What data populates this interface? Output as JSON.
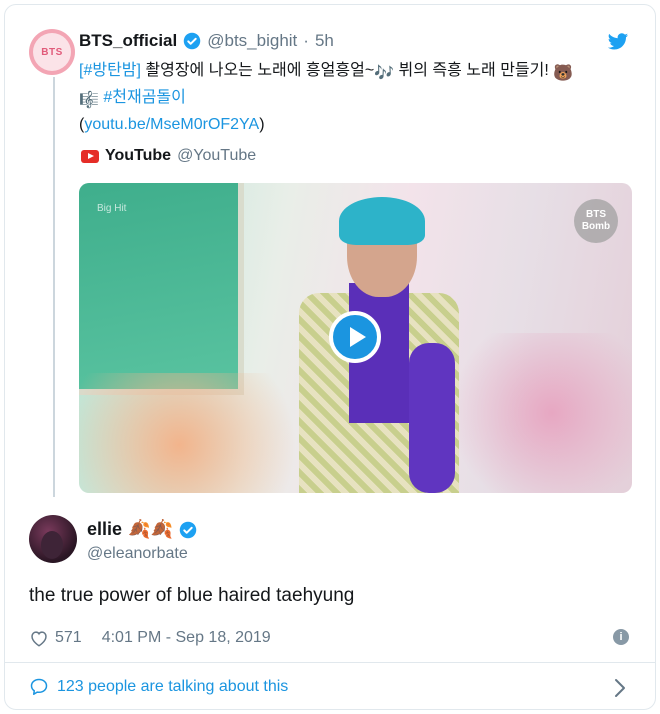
{
  "quoted": {
    "avatar_text": "BTS",
    "name": "BTS_official",
    "handle": "@bts_bighit",
    "separator": "·",
    "time": "5h",
    "hashtag1": "[#방탄밤]",
    "text1": " 촬영장에 나오는 노래에 흥얼흥얼~",
    "text2": " 뷔의 즉흥 노래 만들기! ",
    "hashtag2": " #천재곰돌이",
    "link_open": "(",
    "link": "youtu.be/MseM0rOF2YA",
    "link_close": ")",
    "music_emoji": "🎶",
    "bear_emoji": "🐻",
    "clef_emoji": "🎼"
  },
  "card": {
    "source_name": "YouTube",
    "source_handle": "@YouTube",
    "badge_line1": "BTS",
    "badge_line2": "Bomb",
    "watermark": "Big Hit"
  },
  "tweet": {
    "name": "ellie",
    "name_emoji": "🍂🍂",
    "handle": "@eleanorbate",
    "text": "the true power of blue haired taehyung",
    "likes": "571",
    "timestamp": "4:01 PM - Sep 18, 2019",
    "talking": "123 people are talking about this"
  },
  "colors": {
    "link": "#1b95e0",
    "muted": "#657786",
    "verified": "#1da1f2"
  },
  "icons": [
    "twitter-bird-icon",
    "verified-icon",
    "youtube-icon",
    "play-icon",
    "heart-icon",
    "info-icon",
    "comment-icon",
    "chevron-right-icon"
  ]
}
